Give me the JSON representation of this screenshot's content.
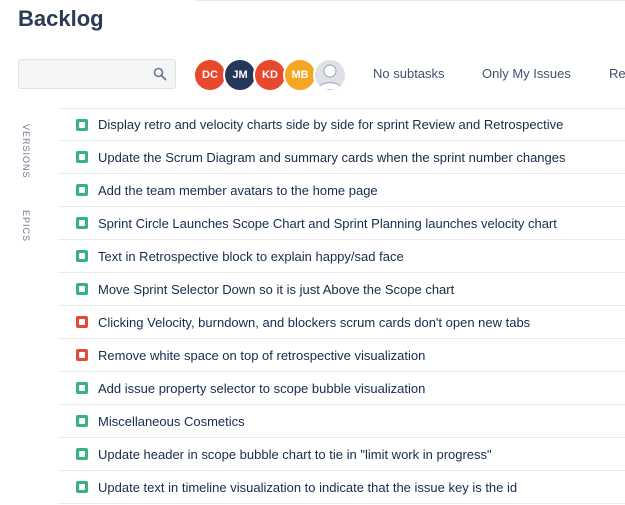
{
  "page": {
    "title": "Backlog"
  },
  "search": {
    "placeholder": ""
  },
  "avatars": [
    {
      "initials": "DC",
      "color": "#e8492c"
    },
    {
      "initials": "JM",
      "color": "#253858"
    },
    {
      "initials": "KD",
      "color": "#e8492c"
    },
    {
      "initials": "MB",
      "color": "#f5a623"
    }
  ],
  "filters": {
    "no_subtasks": "No subtasks",
    "only_my_issues": "Only My Issues",
    "recently_updated": "Re"
  },
  "sidebar": {
    "versions": "VERSIONS",
    "epics": "EPICS"
  },
  "issues": [
    {
      "type": "story",
      "summary": "Display retro and velocity charts side by side for sprint Review and Retrospective"
    },
    {
      "type": "story",
      "summary": "Update the Scrum Diagram and summary cards when the sprint number changes"
    },
    {
      "type": "story",
      "summary": "Add the team member avatars to the home page"
    },
    {
      "type": "story",
      "summary": "Sprint Circle Launches Scope Chart and Sprint Planning launches velocity chart"
    },
    {
      "type": "story",
      "summary": "Text in Retrospective block to explain happy/sad face"
    },
    {
      "type": "story",
      "summary": "Move Sprint Selector Down so it is just Above the Scope chart"
    },
    {
      "type": "bug",
      "summary": "Clicking Velocity, burndown, and blockers scrum cards don't open new tabs"
    },
    {
      "type": "bug",
      "summary": "Remove white space on top of retrospective visualization"
    },
    {
      "type": "story",
      "summary": "Add issue property selector to scope bubble visualization"
    },
    {
      "type": "story",
      "summary": "Miscellaneous Cosmetics"
    },
    {
      "type": "story",
      "summary": "Update header in scope bubble chart to tie in \"limit work in progress\""
    },
    {
      "type": "story",
      "summary": "Update text in timeline visualization to indicate that the issue key is the id"
    }
  ]
}
